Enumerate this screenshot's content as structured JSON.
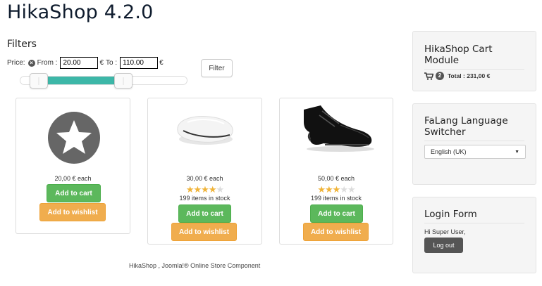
{
  "site": {
    "title": "HikaShop 4.2.0"
  },
  "filters": {
    "heading": "Filters",
    "price_label": "Price:",
    "from_label": "From :",
    "from_value": "20.00",
    "currency_1": "€",
    "to_label": "To :",
    "to_value": "110.00",
    "currency_2": "€",
    "button_label": "Filter",
    "slider": {
      "min_fraction": 0.11,
      "max_fraction": 0.62
    }
  },
  "products": [
    {
      "image_icon": "star-placeholder-icon",
      "price": "20,00 € each",
      "add_to_cart": "Add to cart",
      "add_to_wishlist": "Add to wishlist"
    },
    {
      "image_icon": "computer-mouse-image",
      "price": "30,00 € each",
      "rating": 4,
      "rating_max": 5,
      "stock": "199 items in stock",
      "add_to_cart": "Add to cart",
      "add_to_wishlist": "Add to wishlist"
    },
    {
      "image_icon": "black-shoe-image",
      "price": "50,00 € each",
      "rating": 3,
      "rating_max": 5,
      "stock": "199 items in stock",
      "add_to_cart": "Add to cart",
      "add_to_wishlist": "Add to wishlist"
    }
  ],
  "footer": {
    "text": "HikaShop , Joomla!® Online Store Component"
  },
  "cart_module": {
    "title": "HikaShop Cart Module",
    "cart_icon": "shopping-cart-icon",
    "count": "2",
    "total": "Total : 231,00 €"
  },
  "language_module": {
    "title": "FaLang Language Switcher",
    "selected": "English (UK)"
  },
  "login_module": {
    "title": "Login Form",
    "greeting": "Hi Super User,",
    "logout_label": "Log out"
  },
  "colors": {
    "slider_range": "#3db7a8",
    "cart_button": "#5cb85c",
    "wishlist_button": "#f0ad4e",
    "star_filled": "#f0b43a",
    "star_empty": "#dcdcdc",
    "logout_button": "#555555"
  }
}
